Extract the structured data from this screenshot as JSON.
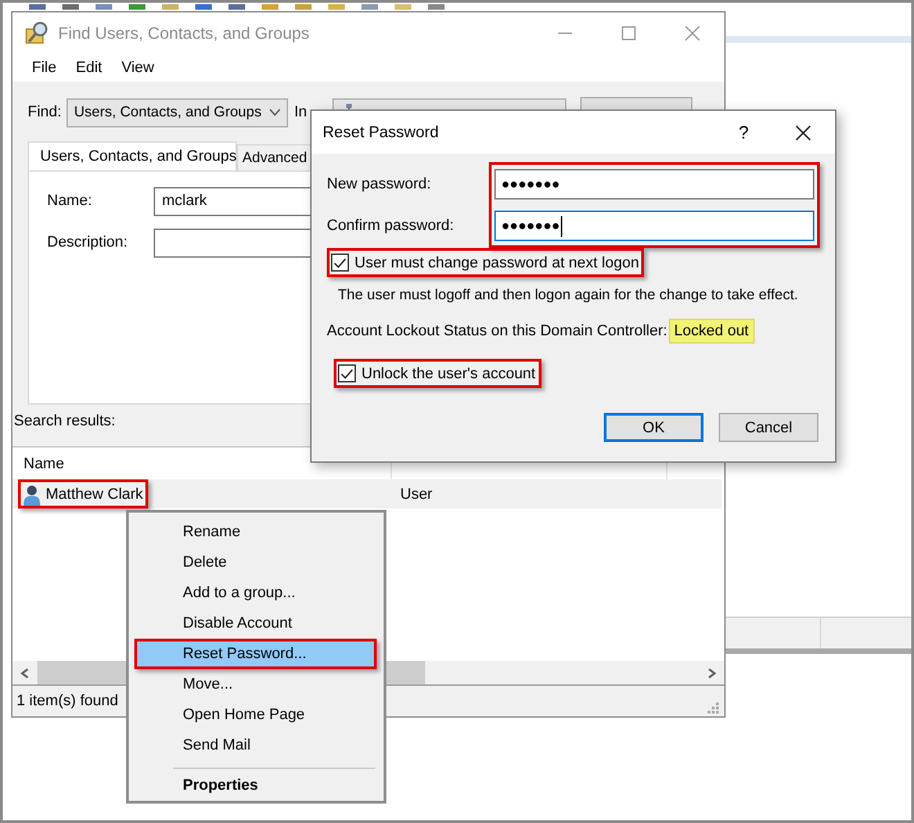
{
  "find_window": {
    "title": "Find Users, Contacts, and Groups",
    "menu": [
      "File",
      "Edit",
      "View"
    ],
    "find_label": "Find:",
    "find_value": "Users, Contacts, and Groups",
    "in_label": "In",
    "tabs": [
      {
        "label": "Users, Contacts, and Groups",
        "selected": true
      },
      {
        "label": "Advanced",
        "selected": false
      }
    ],
    "fields": [
      {
        "label": "Name:",
        "value": "mclark"
      },
      {
        "label": "Description:"
      }
    ],
    "results_label": "Search results:",
    "columns": [
      "Name"
    ],
    "rows": [
      {
        "name": "Matthew Clark",
        "type": "User",
        "selected": true,
        "annotated": true
      }
    ],
    "status": "1 item(s) found"
  },
  "context_menu": {
    "items": [
      {
        "kind": "item",
        "label": "Rename",
        "selected": false,
        "annotated": false
      },
      {
        "kind": "item",
        "label": "Delete",
        "selected": false,
        "annotated": false
      },
      {
        "kind": "item",
        "label": "Add to a group...",
        "selected": false,
        "annotated": false
      },
      {
        "kind": "item",
        "label": "Disable Account",
        "selected": false,
        "annotated": false
      },
      {
        "kind": "item",
        "label": "Reset Password...",
        "selected": true,
        "annotated": true
      },
      {
        "kind": "item",
        "label": "Move...",
        "selected": false,
        "annotated": false
      },
      {
        "kind": "item",
        "label": "Open Home Page",
        "selected": false,
        "annotated": false
      },
      {
        "kind": "item",
        "label": "Send Mail",
        "selected": false,
        "annotated": false
      },
      {
        "kind": "separator"
      },
      {
        "kind": "default",
        "label": "Properties",
        "selected": false,
        "annotated": false
      }
    ]
  },
  "reset_dialog": {
    "title": "Reset Password",
    "help": "?",
    "passwords_annotated": true,
    "passwords": [
      {
        "label": "New password:",
        "value": "●●●●●●●",
        "focused": false
      },
      {
        "label": "Confirm password:",
        "value": "●●●●●●●",
        "focused": true
      }
    ],
    "must_change": {
      "label": "User must change password at next logon",
      "checked": true,
      "annotated": true
    },
    "note": "The user must logoff and then logon again for the change to take effect.",
    "lockout_label": "Account Lockout Status on this Domain Controller:",
    "lockout_status": "Locked out",
    "unlock": {
      "label": "Unlock the user's account",
      "checked": true,
      "annotated": true
    },
    "buttons": [
      {
        "label": "OK",
        "default": true
      },
      {
        "label": "Cancel",
        "default": false
      }
    ]
  }
}
